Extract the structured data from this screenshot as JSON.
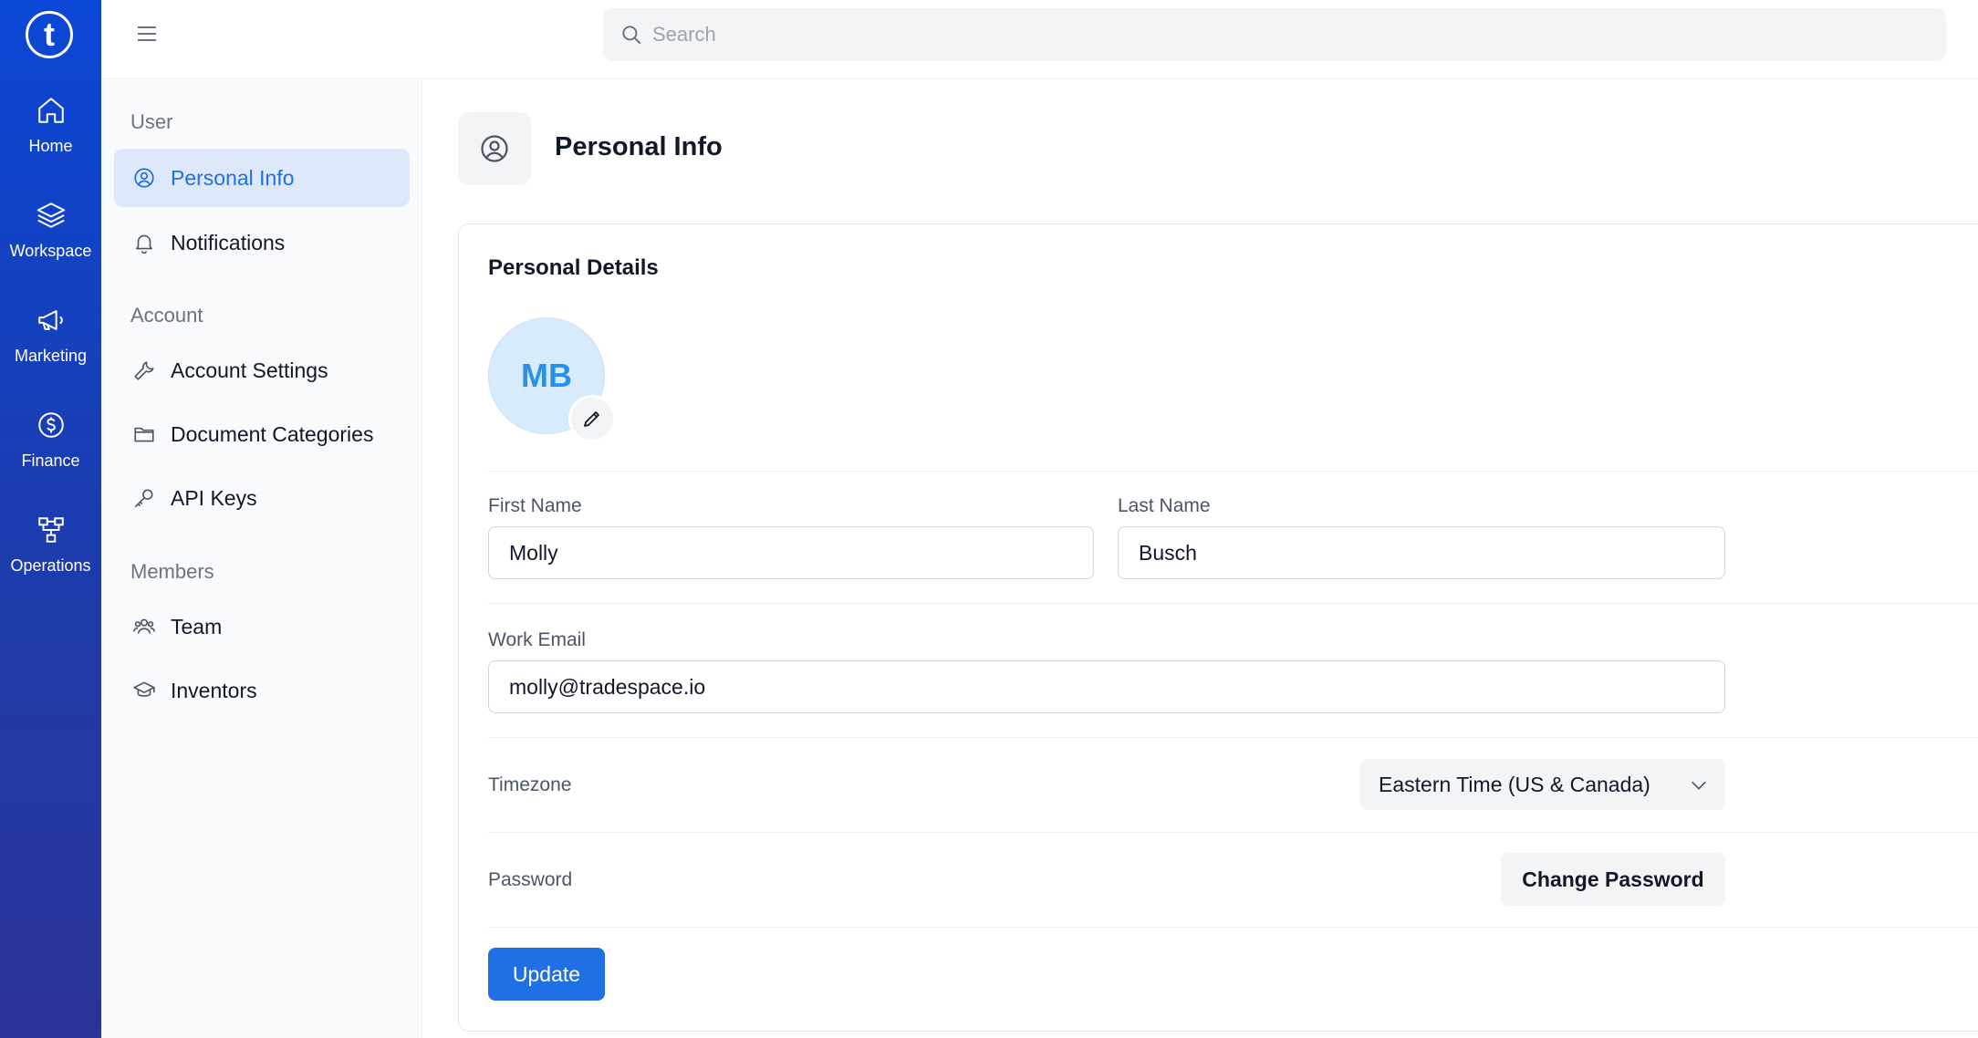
{
  "brand": {
    "logo_letter": "t",
    "accent": "#1f6fe5",
    "rail_color": "#0b47d6"
  },
  "rail": {
    "items": [
      {
        "label": "Home",
        "icon": "home-icon"
      },
      {
        "label": "Workspace",
        "icon": "layers-icon"
      },
      {
        "label": "Marketing",
        "icon": "megaphone-icon"
      },
      {
        "label": "Finance",
        "icon": "dollar-circle-icon"
      },
      {
        "label": "Operations",
        "icon": "flowchart-icon"
      }
    ]
  },
  "topbar": {
    "search_placeholder": "Search"
  },
  "sidenav": {
    "sections": [
      {
        "heading": "User",
        "items": [
          {
            "label": "Personal Info",
            "icon": "user-circle-icon",
            "active": true
          },
          {
            "label": "Notifications",
            "icon": "bell-icon"
          }
        ]
      },
      {
        "heading": "Account",
        "items": [
          {
            "label": "Account Settings",
            "icon": "wrench-icon"
          },
          {
            "label": "Document Categories",
            "icon": "folder-icon"
          },
          {
            "label": "API Keys",
            "icon": "key-icon"
          }
        ]
      },
      {
        "heading": "Members",
        "items": [
          {
            "label": "Team",
            "icon": "users-icon"
          },
          {
            "label": "Inventors",
            "icon": "graduation-cap-icon"
          }
        ]
      }
    ]
  },
  "page": {
    "title": "Personal Info",
    "icon": "user-circle-icon"
  },
  "card": {
    "title": "Personal Details",
    "avatar_initials": "MB",
    "first_name": {
      "label": "First Name",
      "value": "Molly"
    },
    "last_name": {
      "label": "Last Name",
      "value": "Busch"
    },
    "email": {
      "label": "Work Email",
      "value": "molly@tradespace.io"
    },
    "timezone": {
      "label": "Timezone",
      "value": "Eastern Time (US & Canada)"
    },
    "password": {
      "label": "Password",
      "button": "Change Password"
    },
    "update_button": "Update"
  }
}
